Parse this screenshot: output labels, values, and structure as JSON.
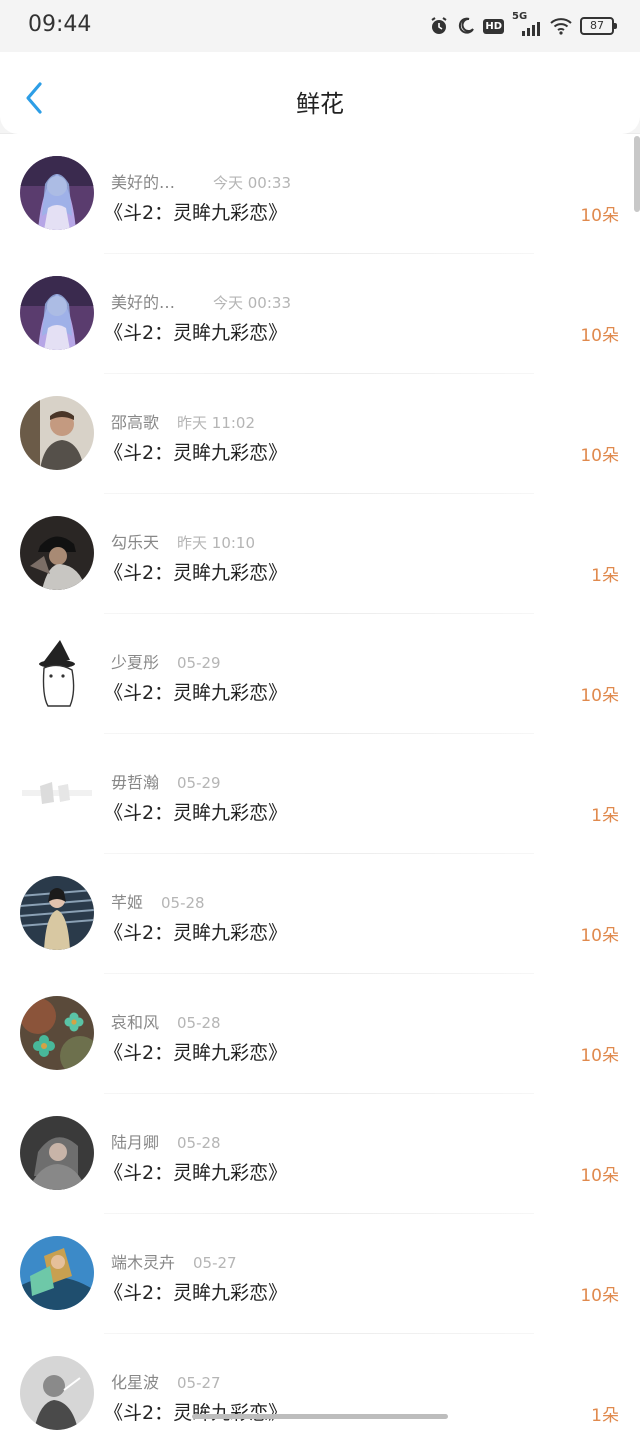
{
  "status_bar": {
    "time": "09:44",
    "battery": "87",
    "network": "5G",
    "hd_label": "HD"
  },
  "header": {
    "title": "鲜花"
  },
  "records": [
    {
      "username": "美好的…",
      "time": "今天 00:33",
      "book": "《斗2：灵眸九彩恋》",
      "count": "10朵",
      "avatar": "anime-girl"
    },
    {
      "username": "美好的…",
      "time": "今天 00:33",
      "book": "《斗2：灵眸九彩恋》",
      "count": "10朵",
      "avatar": "anime-girl"
    },
    {
      "username": "邵高歌",
      "time": "昨天 11:02",
      "book": "《斗2：灵眸九彩恋》",
      "count": "10朵",
      "avatar": "man-portrait"
    },
    {
      "username": "勾乐天",
      "time": "昨天 10:10",
      "book": "《斗2：灵眸九彩恋》",
      "count": "1朵",
      "avatar": "cap-person"
    },
    {
      "username": "少夏彤",
      "time": "05-29",
      "book": "《斗2：灵眸九彩恋》",
      "count": "10朵",
      "avatar": "witch-cat"
    },
    {
      "username": "毋哲瀚",
      "time": "05-29",
      "book": "《斗2：灵眸九彩恋》",
      "count": "1朵",
      "avatar": "faded-sketch"
    },
    {
      "username": "芊姬",
      "time": "05-28",
      "book": "《斗2：灵眸九彩恋》",
      "count": "10朵",
      "avatar": "girl-stairs"
    },
    {
      "username": "哀和风",
      "time": "05-28",
      "book": "《斗2：灵眸九彩恋》",
      "count": "10朵",
      "avatar": "flowers"
    },
    {
      "username": "陆月卿",
      "time": "05-28",
      "book": "《斗2：灵眸九彩恋》",
      "count": "10朵",
      "avatar": "hooded-figure"
    },
    {
      "username": "端木灵卉",
      "time": "05-27",
      "book": "《斗2：灵眸九彩恋》",
      "count": "10朵",
      "avatar": "game-warrior"
    },
    {
      "username": "化星波",
      "time": "05-27",
      "book": "《斗2：灵眸九彩恋》",
      "count": "1朵",
      "avatar": "bw-smoker"
    }
  ],
  "colors": {
    "accent": "#2d9ee6",
    "count": "#e08a4e",
    "text_primary": "#222222",
    "text_secondary": "#888888"
  }
}
